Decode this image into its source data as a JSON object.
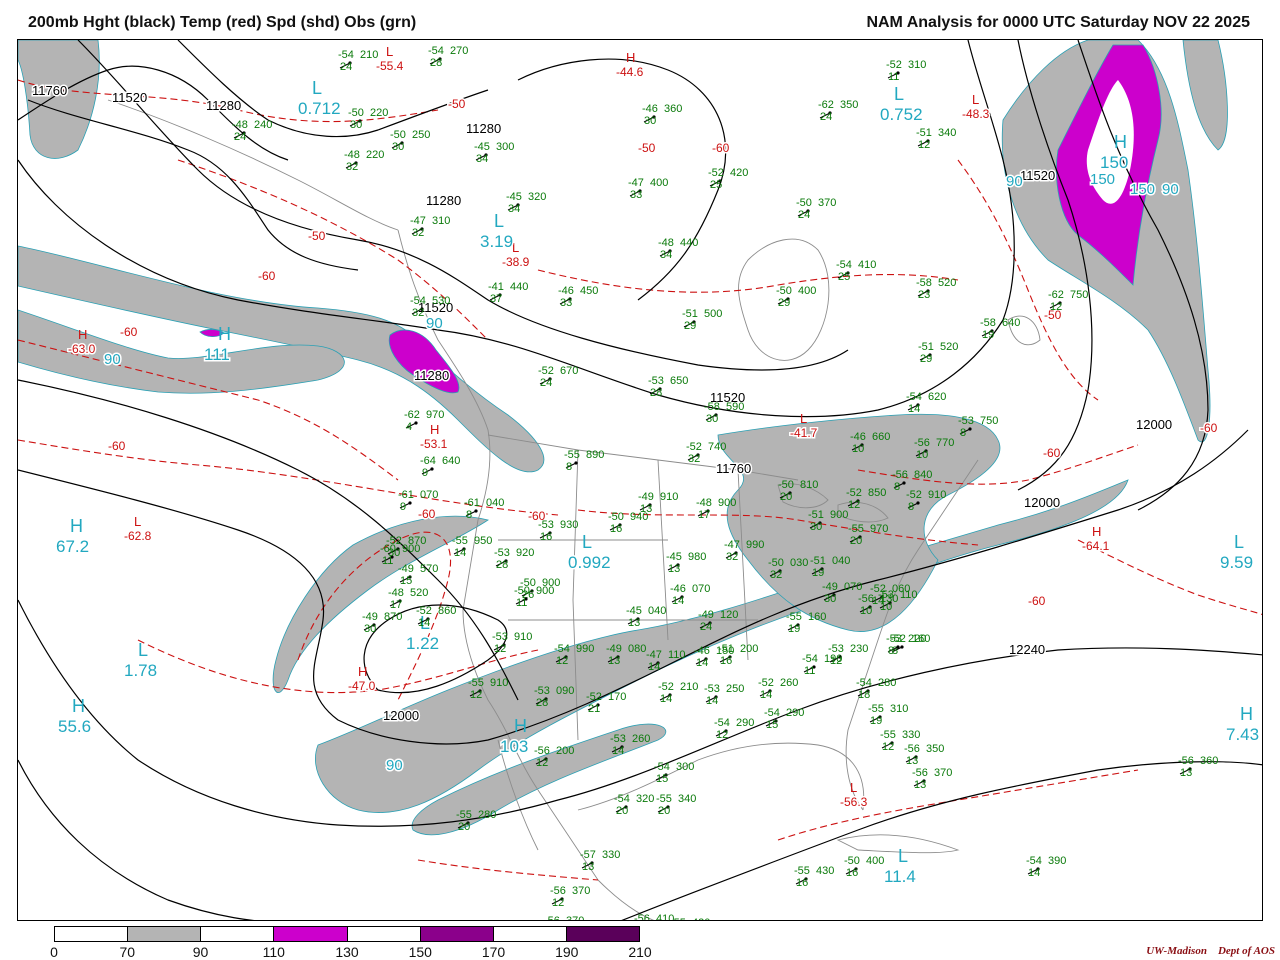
{
  "header": {
    "left_title": "200mb Hght (black) Temp (red) Spd (shd) Obs (grn)",
    "right_title": "NAM Analysis for 0000 UTC Saturday  NOV 22 2025"
  },
  "colors": {
    "height": "#000000",
    "temp": "#cc1111",
    "obs": "#0a7a0a",
    "hl": "#22a8c0",
    "borders": "#888888",
    "frame": "#000000"
  },
  "legend": {
    "labels": [
      "0",
      "70",
      "90",
      "110",
      "130",
      "150",
      "170",
      "190",
      "210"
    ],
    "bins": [
      "#ffffff",
      "#b4b4b4",
      "#ffffff",
      "#cc00cc",
      "#ffffff",
      "#8b008b",
      "#ffffff",
      "#5a005a"
    ]
  },
  "height_labels": [
    "11760",
    "11520",
    "11280",
    "11280",
    "11520",
    "11280",
    "11520",
    "11520",
    "11760",
    "12000",
    "12000",
    "12000",
    "12240",
    "11280"
  ],
  "temp_labels": [
    "-50",
    "-50",
    "-60",
    "-50",
    "-60",
    "-60",
    "-60",
    "-60",
    "-60",
    "-60",
    "-60",
    "-50",
    "-60"
  ],
  "temp_extrema": [
    "-55.4",
    "-44.6",
    "-48.3",
    "-63.0",
    "-38.9",
    "-53.1",
    "-62.8",
    "-47.0",
    "-41.7",
    "-64.1",
    "-56.3"
  ],
  "hl_labels": [
    {
      "kind": "L",
      "value": "0.712"
    },
    {
      "kind": "L",
      "value": "0.752"
    },
    {
      "kind": "H",
      "value": "150"
    },
    {
      "kind": "L",
      "value": "3.19"
    },
    {
      "kind": "H",
      "value": "67.2"
    },
    {
      "kind": "L",
      "value": "1.78"
    },
    {
      "kind": "H",
      "value": "55.6"
    },
    {
      "kind": "L",
      "value": "0.992"
    },
    {
      "kind": "L",
      "value": "9.59"
    },
    {
      "kind": "L",
      "value": "11.4"
    },
    {
      "kind": "H",
      "value": "103"
    },
    {
      "kind": "H",
      "value": "7.43"
    },
    {
      "kind": "L",
      "value": "1.22"
    },
    {
      "kind": "H",
      "value": "111"
    }
  ],
  "speed_labels": [
    "90",
    "90",
    "90",
    "150",
    "90",
    "90",
    "150"
  ],
  "obs": [
    {
      "temp": "-54",
      "hgt": "210",
      "dd": "24"
    },
    {
      "temp": "-54",
      "hgt": "270",
      "dd": "28"
    },
    {
      "temp": "-50",
      "hgt": "220",
      "dd": "30"
    },
    {
      "temp": "-48",
      "hgt": "240",
      "dd": "24"
    },
    {
      "temp": "-50",
      "hgt": "250",
      "dd": "30"
    },
    {
      "temp": "-48",
      "hgt": "220",
      "dd": "32"
    },
    {
      "temp": "-45",
      "hgt": "300",
      "dd": "34"
    },
    {
      "temp": "-46",
      "hgt": "360",
      "dd": "30"
    },
    {
      "temp": "-52",
      "hgt": "310",
      "dd": "11"
    },
    {
      "temp": "-62",
      "hgt": "350",
      "dd": "24"
    },
    {
      "temp": "-51",
      "hgt": "340",
      "dd": "12"
    },
    {
      "temp": "-47",
      "hgt": "400",
      "dd": "33"
    },
    {
      "temp": "-52",
      "hgt": "420",
      "dd": "25"
    },
    {
      "temp": "-45",
      "hgt": "320",
      "dd": "34"
    },
    {
      "temp": "-47",
      "hgt": "310",
      "dd": "32"
    },
    {
      "temp": "-50",
      "hgt": "370",
      "dd": "24"
    },
    {
      "temp": "-48",
      "hgt": "440",
      "dd": "34"
    },
    {
      "temp": "-54",
      "hgt": "410",
      "dd": "25"
    },
    {
      "temp": "-50",
      "hgt": "400",
      "dd": "29"
    },
    {
      "temp": "-58",
      "hgt": "520",
      "dd": "23"
    },
    {
      "temp": "-62",
      "hgt": "750",
      "dd": "12"
    },
    {
      "temp": "-41",
      "hgt": "440",
      "dd": "37"
    },
    {
      "temp": "-46",
      "hgt": "450",
      "dd": "33"
    },
    {
      "temp": "-51",
      "hgt": "500",
      "dd": "29"
    },
    {
      "temp": "-58",
      "hgt": "640",
      "dd": "19"
    },
    {
      "temp": "-51",
      "hgt": "520",
      "dd": "29"
    },
    {
      "temp": "-54",
      "hgt": "530",
      "dd": "32"
    },
    {
      "temp": "-52",
      "hgt": "670",
      "dd": "24"
    },
    {
      "temp": "-53",
      "hgt": "650",
      "dd": "28"
    },
    {
      "temp": "-58",
      "hgt": "590",
      "dd": "30"
    },
    {
      "temp": "-54",
      "hgt": "620",
      "dd": "14"
    },
    {
      "temp": "-53",
      "hgt": "750",
      "dd": "8"
    },
    {
      "temp": "-62",
      "hgt": "970",
      "dd": "4"
    },
    {
      "temp": "-64",
      "hgt": "640",
      "dd": "9"
    },
    {
      "temp": "-55",
      "hgt": "890",
      "dd": "8"
    },
    {
      "temp": "-52",
      "hgt": "740",
      "dd": "32"
    },
    {
      "temp": "-46",
      "hgt": "660",
      "dd": "10"
    },
    {
      "temp": "-56",
      "hgt": "770",
      "dd": "10"
    },
    {
      "temp": "-61",
      "hgt": "070",
      "dd": "9"
    },
    {
      "temp": "-61",
      "hgt": "040",
      "dd": "8"
    },
    {
      "temp": "-49",
      "hgt": "910",
      "dd": "13"
    },
    {
      "temp": "-48",
      "hgt": "900",
      "dd": "17"
    },
    {
      "temp": "-50",
      "hgt": "810",
      "dd": "20"
    },
    {
      "temp": "-52",
      "hgt": "850",
      "dd": "12"
    },
    {
      "temp": "-56",
      "hgt": "840",
      "dd": "8"
    },
    {
      "temp": "-52",
      "hgt": "910",
      "dd": "8"
    },
    {
      "temp": "-50",
      "hgt": "940",
      "dd": "16"
    },
    {
      "temp": "-53",
      "hgt": "930",
      "dd": "16"
    },
    {
      "temp": "-51",
      "hgt": "900",
      "dd": "30"
    },
    {
      "temp": "-55",
      "hgt": "970",
      "dd": "20"
    },
    {
      "temp": "-55",
      "hgt": "950",
      "dd": "14"
    },
    {
      "temp": "-53",
      "hgt": "920",
      "dd": "28"
    },
    {
      "temp": "-60",
      "hgt": "900",
      "dd": "11"
    },
    {
      "temp": "-45",
      "hgt": "980",
      "dd": "13"
    },
    {
      "temp": "-47",
      "hgt": "990",
      "dd": "32"
    },
    {
      "temp": "-50",
      "hgt": "030",
      "dd": "32"
    },
    {
      "temp": "-51",
      "hgt": "040",
      "dd": "19"
    },
    {
      "temp": "-50",
      "hgt": "900",
      "dd": "26"
    },
    {
      "temp": "-49",
      "hgt": "070",
      "dd": "30"
    },
    {
      "temp": "-52",
      "hgt": "060",
      "dd": "14"
    },
    {
      "temp": "-46",
      "hgt": "070",
      "dd": "14"
    },
    {
      "temp": "-45",
      "hgt": "040",
      "dd": "13"
    },
    {
      "temp": "-49",
      "hgt": "120",
      "dd": "24"
    },
    {
      "temp": "-53",
      "hgt": "110",
      "dd": "10"
    },
    {
      "temp": "-56",
      "hgt": "130",
      "dd": "10"
    },
    {
      "temp": "-55",
      "hgt": "160",
      "dd": "19"
    },
    {
      "temp": "-52",
      "hgt": "160",
      "dd": "8"
    },
    {
      "temp": "-53",
      "hgt": "910",
      "dd": "12"
    },
    {
      "temp": "-54",
      "hgt": "990",
      "dd": "12"
    },
    {
      "temp": "-49",
      "hgt": "080",
      "dd": "13"
    },
    {
      "temp": "-47",
      "hgt": "110",
      "dd": "14"
    },
    {
      "temp": "-46",
      "hgt": "150",
      "dd": "14"
    },
    {
      "temp": "-51",
      "hgt": "200",
      "dd": "16"
    },
    {
      "temp": "-54",
      "hgt": "190",
      "dd": "11"
    },
    {
      "temp": "-53",
      "hgt": "230",
      "dd": "12"
    },
    {
      "temp": "-53",
      "hgt": "220",
      "dd": "8"
    },
    {
      "temp": "-55",
      "hgt": "910",
      "dd": "12"
    },
    {
      "temp": "-53",
      "hgt": "090",
      "dd": "28"
    },
    {
      "temp": "-52",
      "hgt": "170",
      "dd": "21"
    },
    {
      "temp": "-52",
      "hgt": "210",
      "dd": "14"
    },
    {
      "temp": "-53",
      "hgt": "250",
      "dd": "14"
    },
    {
      "temp": "-52",
      "hgt": "260",
      "dd": "14"
    },
    {
      "temp": "-54",
      "hgt": "280",
      "dd": "18"
    },
    {
      "temp": "-54",
      "hgt": "290",
      "dd": "12"
    },
    {
      "temp": "-54",
      "hgt": "290",
      "dd": "15"
    },
    {
      "temp": "-55",
      "hgt": "310",
      "dd": "19"
    },
    {
      "temp": "-55",
      "hgt": "330",
      "dd": "12"
    },
    {
      "temp": "-56",
      "hgt": "350",
      "dd": "13"
    },
    {
      "temp": "-56",
      "hgt": "370",
      "dd": "13"
    },
    {
      "temp": "-53",
      "hgt": "260",
      "dd": "14"
    },
    {
      "temp": "-56",
      "hgt": "200",
      "dd": "12"
    },
    {
      "temp": "-54",
      "hgt": "300",
      "dd": "15"
    },
    {
      "temp": "-54",
      "hgt": "320",
      "dd": "20"
    },
    {
      "temp": "-55",
      "hgt": "340",
      "dd": "20"
    },
    {
      "temp": "-55",
      "hgt": "280",
      "dd": "20"
    },
    {
      "temp": "-57",
      "hgt": "330",
      "dd": "13"
    },
    {
      "temp": "-56",
      "hgt": "370",
      "dd": "12"
    },
    {
      "temp": "-56",
      "hgt": "370",
      "dd": "12"
    },
    {
      "temp": "-56",
      "hgt": "410",
      "dd": "13"
    },
    {
      "temp": "-55",
      "hgt": "420",
      "dd": "16"
    },
    {
      "temp": "-55",
      "hgt": "430",
      "dd": "16"
    },
    {
      "temp": "-50",
      "hgt": "400",
      "dd": "16"
    },
    {
      "temp": "-54",
      "hgt": "390",
      "dd": "14"
    },
    {
      "temp": "-56",
      "hgt": "360",
      "dd": "13"
    },
    {
      "temp": "-52",
      "hgt": "870",
      "dd": "30"
    },
    {
      "temp": "-49",
      "hgt": "870",
      "dd": "30"
    },
    {
      "temp": "-52",
      "hgt": "860",
      "dd": "14"
    },
    {
      "temp": "-50",
      "hgt": "900",
      "dd": "11"
    },
    {
      "temp": "-49",
      "hgt": "570",
      "dd": "15"
    },
    {
      "temp": "-48",
      "hgt": "520",
      "dd": "17"
    }
  ],
  "credit": {
    "left": "UW-Madison",
    "right": "Dept of AOS"
  }
}
